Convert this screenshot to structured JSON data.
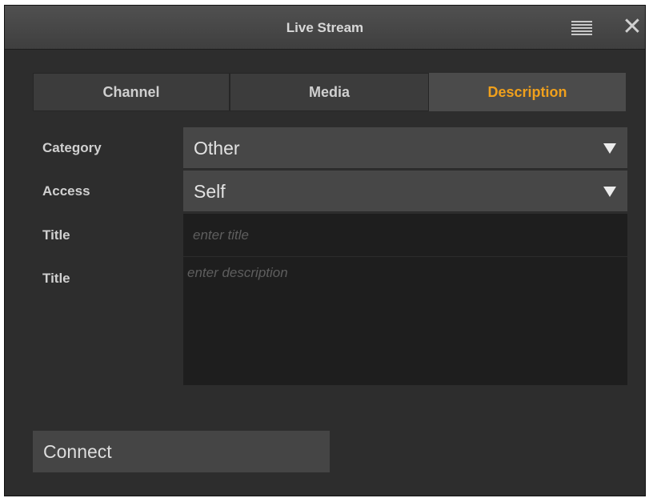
{
  "window": {
    "title": "Live Stream",
    "menu_icon": "hamburger-menu-icon",
    "close_icon": "close-x-icon"
  },
  "tabs": [
    {
      "label": "Channel",
      "active": false
    },
    {
      "label": "Media",
      "active": false
    },
    {
      "label": "Description",
      "active": true
    }
  ],
  "form": {
    "category": {
      "label": "Category",
      "value": "Other"
    },
    "access": {
      "label": "Access",
      "value": "Self"
    },
    "title": {
      "label": "Title",
      "value": "",
      "placeholder": "enter title"
    },
    "description": {
      "label": "Title",
      "value": "",
      "placeholder": "enter description"
    }
  },
  "actions": {
    "connect_label": "Connect"
  },
  "colors": {
    "accent": "#f0a01c",
    "window_bg": "#2d2d2d",
    "titlebar": "#474747",
    "field_bg": "#474747",
    "input_bg": "#1e1e1e"
  }
}
